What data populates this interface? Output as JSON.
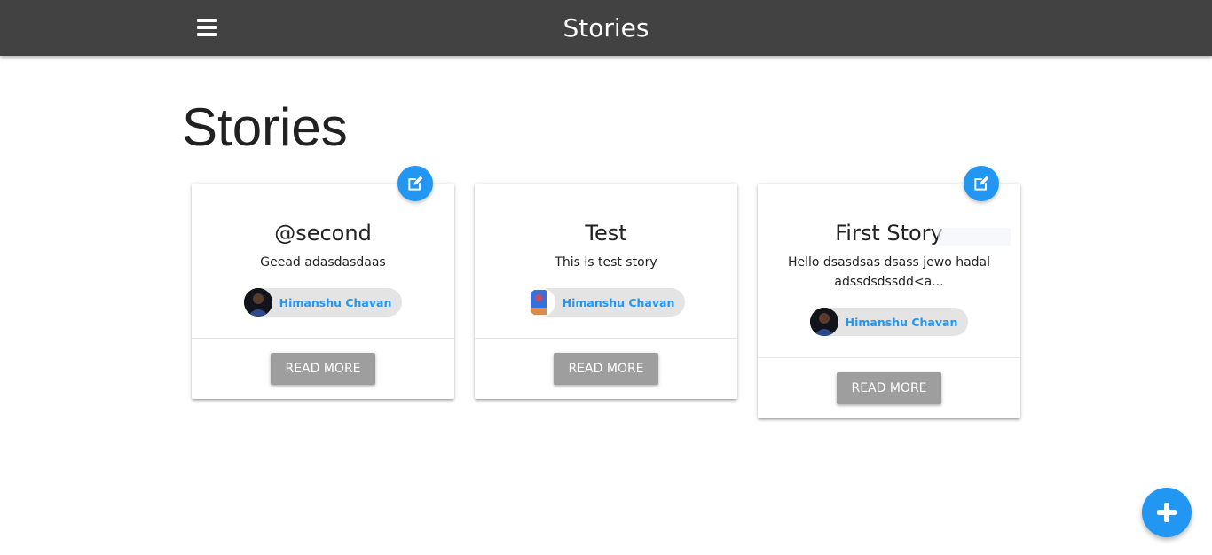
{
  "navbar": {
    "brand": "Stories",
    "menu_icon": "hamburger-menu-icon"
  },
  "page": {
    "title": "Stories"
  },
  "stories": [
    {
      "title": "@second",
      "excerpt": "Geead adasdasdaas",
      "author": "Himanshu Chavan",
      "action_label": "READ MORE",
      "editable": true,
      "edit_icon": "edit-icon"
    },
    {
      "title": "Test",
      "excerpt": "This is test story",
      "author": "Himanshu Chavan",
      "action_label": "READ MORE",
      "editable": false
    },
    {
      "title": "First Story",
      "excerpt": "Hello dsasdsas dsass jewo hadal adssdsdssdd<a...",
      "author": "Himanshu Chavan",
      "action_label": "READ MORE",
      "editable": true,
      "edit_icon": "edit-icon"
    }
  ],
  "fab": {
    "icon": "plus-icon"
  },
  "colors": {
    "navbar": "#424242",
    "accent": "#2196f3",
    "button": "#9e9e9e",
    "chip": "#e4e4e4"
  }
}
